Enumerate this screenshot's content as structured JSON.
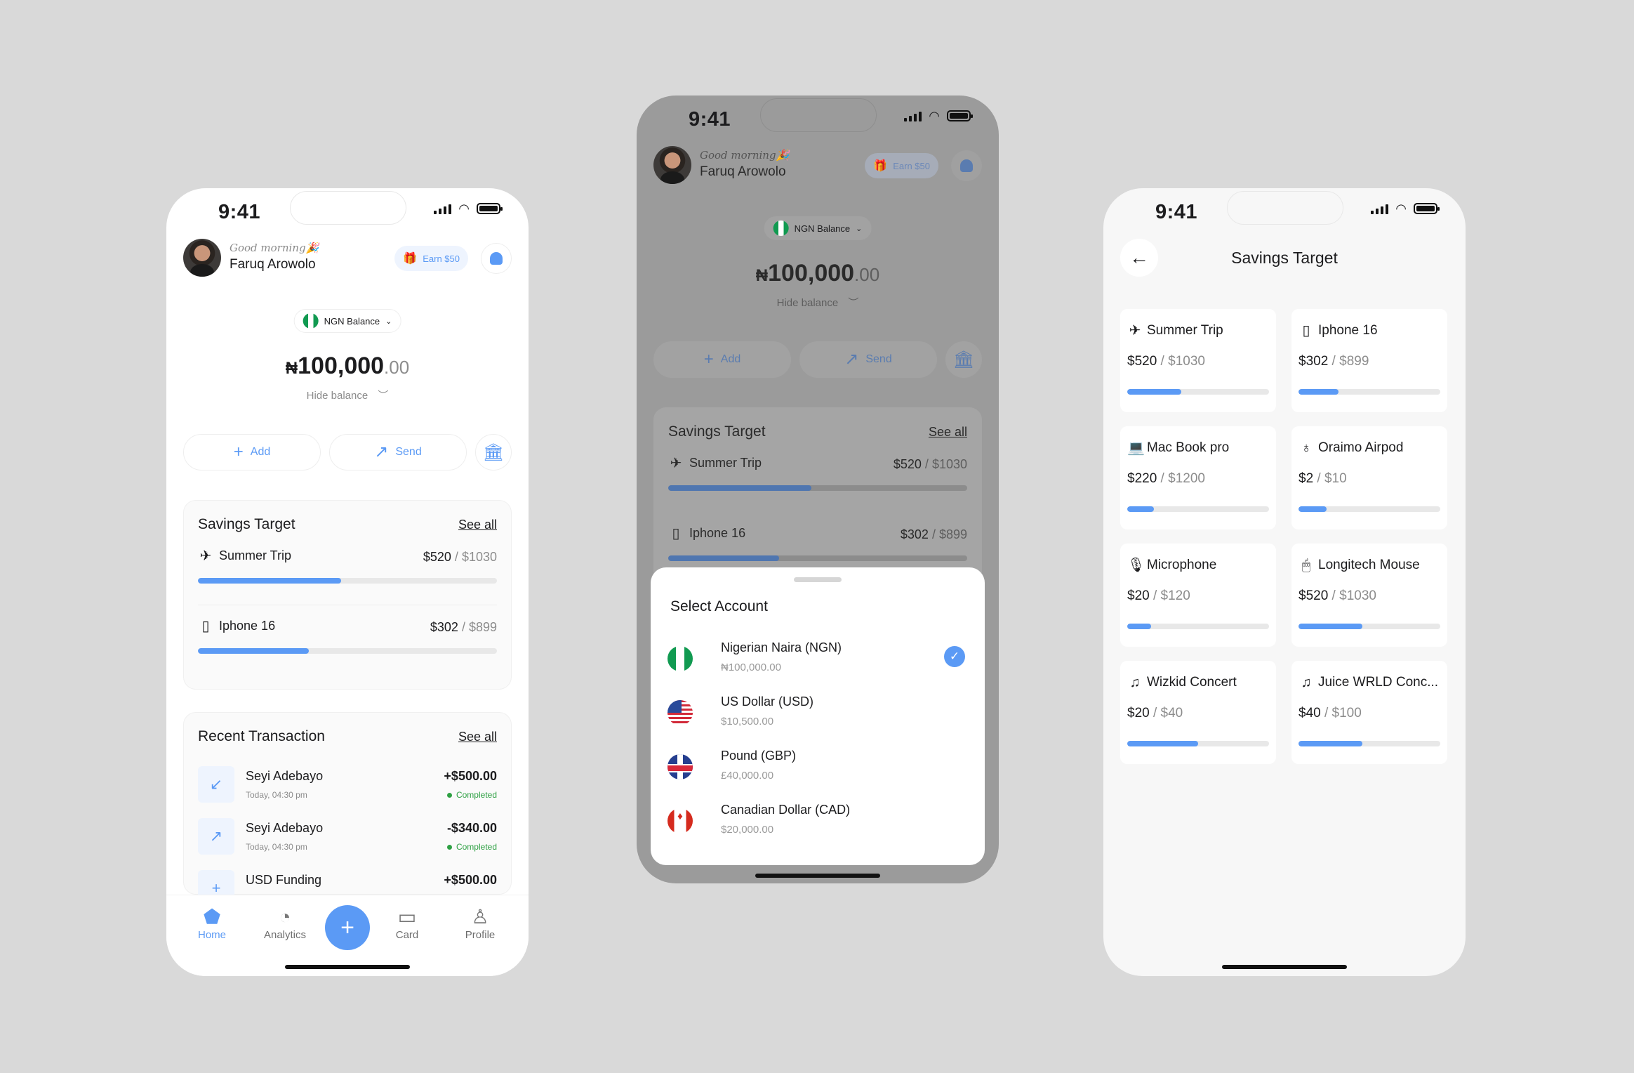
{
  "status_time": "9:41",
  "user": {
    "greeting": "Good morning🎉",
    "name": "Faruq Arowolo"
  },
  "earn_label": "Earn $50",
  "balance": {
    "selector_label": "NGN Balance",
    "currency_symbol": "₦",
    "whole": "100,000",
    "decimal": ".00",
    "hide_label": "Hide balance"
  },
  "actions": {
    "add": "Add",
    "send": "Send"
  },
  "savings": {
    "title": "Savings Target",
    "see_all": "See all",
    "items": [
      {
        "name": "Summer Trip",
        "icon": "airplane-icon",
        "saved": "$520",
        "target": "$1030",
        "progress": 0.48
      },
      {
        "name": "Iphone 16",
        "icon": "phone-icon",
        "saved": "$302",
        "target": "$899",
        "progress": 0.37
      }
    ]
  },
  "transactions": {
    "title": "Recent Transaction",
    "see_all": "See all",
    "items": [
      {
        "name": "Seyi Adebayo",
        "time": "Today, 04:30 pm",
        "amount": "+$500.00",
        "status": "Completed",
        "icon": "arrow-down-left-icon"
      },
      {
        "name": "Seyi Adebayo",
        "time": "Today, 04:30 pm",
        "amount": "-$340.00",
        "status": "Completed",
        "icon": "arrow-up-right-icon"
      },
      {
        "name": "USD Funding",
        "time": "",
        "amount": "+$500.00",
        "status": "",
        "icon": "plus-icon"
      }
    ]
  },
  "tabs": {
    "home": "Home",
    "analytics": "Analytics",
    "card": "Card",
    "profile": "Profile"
  },
  "select_account": {
    "title": "Select Account",
    "accounts": [
      {
        "name": "Nigerian Naira (NGN)",
        "balance": "₦100,000.00",
        "flag": "ng",
        "selected": true
      },
      {
        "name": "US Dollar (USD)",
        "balance": "$10,500.00",
        "flag": "us",
        "selected": false
      },
      {
        "name": "Pound (GBP)",
        "balance": "£40,000.00",
        "flag": "gb",
        "selected": false
      },
      {
        "name": "Canadian Dollar (CAD)",
        "balance": "$20,000.00",
        "flag": "ca",
        "selected": false
      }
    ]
  },
  "savings_page": {
    "title": "Savings Target",
    "items": [
      {
        "name": "Summer Trip",
        "icon": "airplane-icon",
        "saved": "$520",
        "target": "$1030",
        "progress": 0.38
      },
      {
        "name": "Iphone 16",
        "icon": "phone-icon",
        "saved": "$302",
        "target": "$899",
        "progress": 0.28
      },
      {
        "name": "Mac Book pro",
        "icon": "laptop-icon",
        "saved": "$220",
        "target": "$1200",
        "progress": 0.19
      },
      {
        "name": "Oraimo Airpod",
        "icon": "earbuds-icon",
        "saved": "$2",
        "target": "$10",
        "progress": 0.2
      },
      {
        "name": "Microphone",
        "icon": "microphone-icon",
        "saved": "$20",
        "target": "$120",
        "progress": 0.17
      },
      {
        "name": "Longitech Mouse",
        "icon": "mouse-icon",
        "saved": "$520",
        "target": "$1030",
        "progress": 0.45
      },
      {
        "name": "Wizkid Concert",
        "icon": "music-icon",
        "saved": "$20",
        "target": "$40",
        "progress": 0.5
      },
      {
        "name": "Juice WRLD Conc...",
        "icon": "music-icon",
        "saved": "$40",
        "target": "$100",
        "progress": 0.45
      }
    ]
  },
  "colors": {
    "accent": "#5b9af5",
    "success": "#2ea043",
    "background": "#d9d9d9"
  }
}
